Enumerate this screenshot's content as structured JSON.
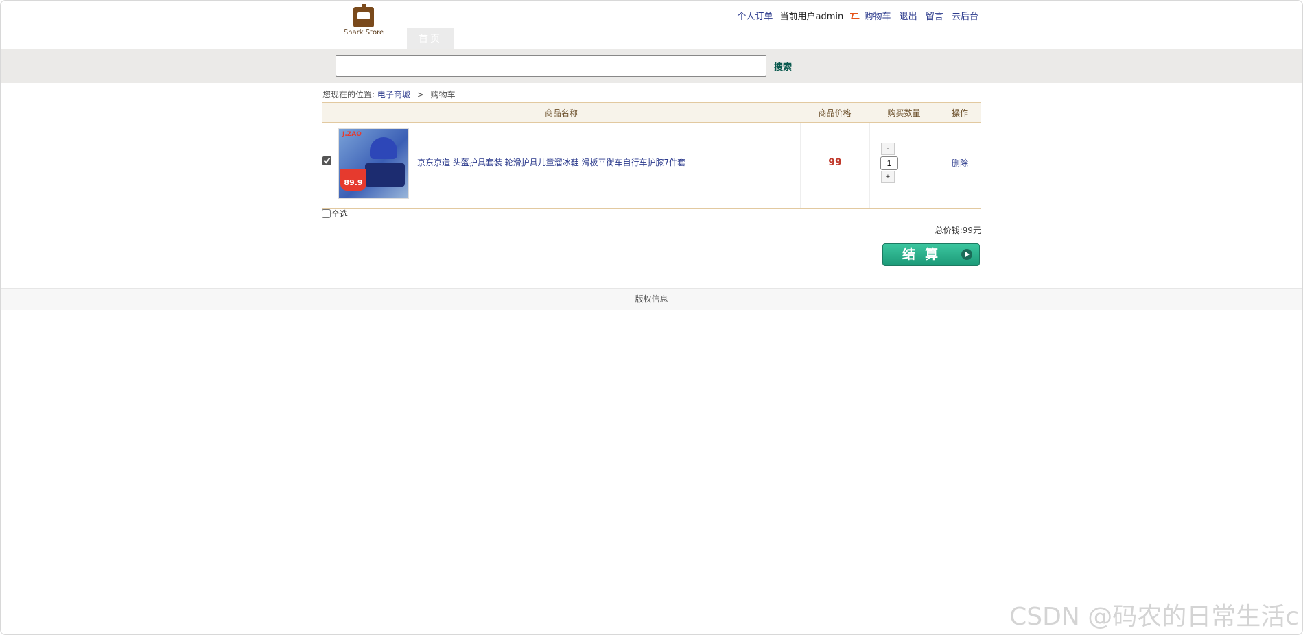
{
  "header": {
    "logo_text": "Shark Store",
    "nav_tab": "首页",
    "links": {
      "orders": "个人订单",
      "current_user": "当前用户admin",
      "cart": "购物车",
      "logout": "退出",
      "message": "留言",
      "admin": "去后台"
    }
  },
  "search": {
    "placeholder": "",
    "button_label": "搜索"
  },
  "breadcrumb": {
    "prefix": "您现在的位置:",
    "home": "电子商城",
    "separator": ">",
    "current": "购物车"
  },
  "table": {
    "headers": [
      "商品名称",
      "商品价格",
      "购买数量",
      "操作"
    ],
    "rows": [
      {
        "checked": true,
        "image_brand": "J.ZAO",
        "image_price": "89.9",
        "name": "京东京造 头盔护具套装 轮滑护具儿童溜冰鞋 滑板平衡车自行车护膝7件套",
        "price": "99",
        "qty": "1",
        "minus": "-",
        "plus": "+",
        "action": "删除"
      }
    ]
  },
  "select_all_label": "全选",
  "total_label": "总价钱:99元",
  "checkout_label": "结算",
  "footer": "版权信息",
  "watermark": "CSDN @码农的日常生活c"
}
